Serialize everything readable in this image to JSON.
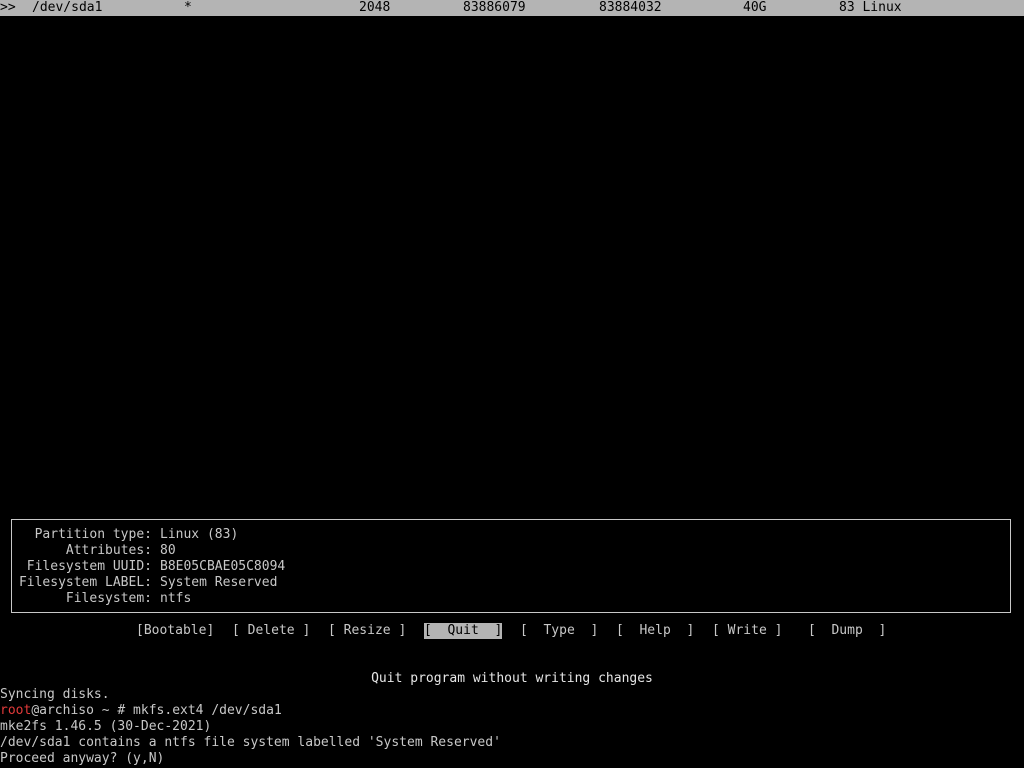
{
  "partition_row": {
    "marker": ">>",
    "device": "/dev/sda1",
    "boot": "*",
    "start": "2048",
    "end": "83886079",
    "sectors": "83884032",
    "size": "40G",
    "type": "83 Linux"
  },
  "info": {
    "items": [
      {
        "key": "Partition type:",
        "value": "Linux (83)"
      },
      {
        "key": "Attributes:",
        "value": "80"
      },
      {
        "key": "Filesystem UUID:",
        "value": "B8E05CBAE05C8094"
      },
      {
        "key": "Filesystem LABEL:",
        "value": "System Reserved"
      },
      {
        "key": "Filesystem:",
        "value": "ntfs"
      }
    ]
  },
  "menu": {
    "items": [
      {
        "label": "[Bootable]"
      },
      {
        "label": "[ Delete ]"
      },
      {
        "label": "[ Resize ]"
      },
      {
        "label": "[  Quit  ]"
      },
      {
        "label": "[  Type  ]"
      },
      {
        "label": "[  Help  ]"
      },
      {
        "label": "[ Write ]"
      },
      {
        "label": "[  Dump  ]"
      }
    ],
    "selected": "[  Quit  ]"
  },
  "hint": "Quit program without writing changes",
  "terminal": {
    "line1": "Syncing disks.",
    "prompt_user": "root",
    "prompt_rest": "@archiso ~ # mkfs.ext4 /dev/sda1",
    "line3": "mke2fs 1.46.5 (30-Dec-2021)",
    "line4": "/dev/sda1 contains a ntfs file system labelled 'System Reserved'",
    "line5": "Proceed anyway? (y,N)"
  },
  "colors": {
    "background": "#000000",
    "text": "#c8c8c8",
    "highlight": "#b4b4b4",
    "prompt_user": "#e23a3a"
  }
}
